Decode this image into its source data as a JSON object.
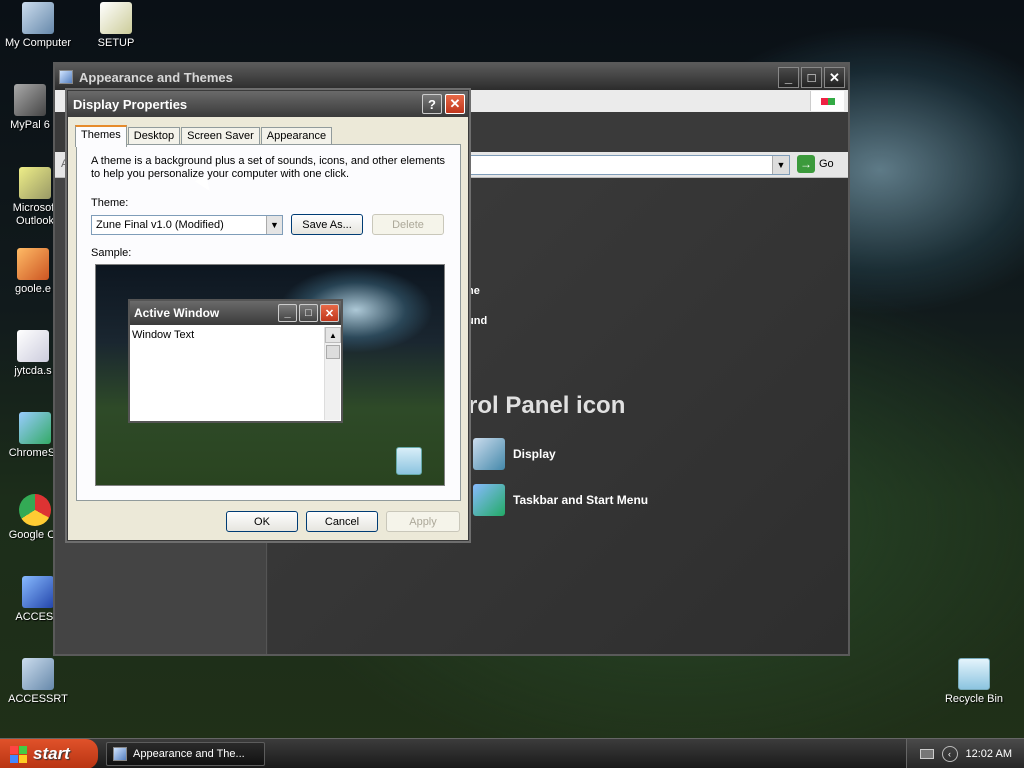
{
  "desktop": {
    "icons": [
      {
        "label": "My Computer",
        "icon": "my-computer-icon"
      },
      {
        "label": "SETUP",
        "icon": "setup-icon"
      },
      {
        "label": "MyPal 6",
        "icon": "mypal-icon"
      },
      {
        "label": "Microsoft Outlook",
        "icon": "outlook-icon"
      },
      {
        "label": "goole.e",
        "icon": "goole-icon"
      },
      {
        "label": "jytcda.s",
        "icon": "jytcda-icon"
      },
      {
        "label": "ChromeSe",
        "icon": "chromese-icon"
      },
      {
        "label": "Google Ch",
        "icon": "google-chrome-icon"
      },
      {
        "label": "ACCESS",
        "icon": "access-icon"
      },
      {
        "label": "ACCESSRT",
        "icon": "accessrt-icon"
      },
      {
        "label": "Recycle Bin",
        "icon": "recycle-bin-icon"
      }
    ]
  },
  "bg_window": {
    "title": "Appearance and Themes",
    "address_label": "A",
    "go_label": "Go",
    "pick_task_items": [
      "ne",
      "und"
    ],
    "cp_heading": "rol Panel icon",
    "cp_links": [
      "Display",
      "Taskbar and Start Menu"
    ]
  },
  "dialog": {
    "title": "Display Properties",
    "help_label": "?",
    "close_label": "✕",
    "tabs": [
      "Themes",
      "Desktop",
      "Screen Saver",
      "Appearance"
    ],
    "active_tab": "Themes",
    "description": "A theme is a background plus a set of sounds, icons, and other elements to help you personalize your computer with one click.",
    "theme_label": "Theme:",
    "theme_value": "Zune Final v1.0 (Modified)",
    "save_as_label": "Save As...",
    "delete_label": "Delete",
    "sample_label": "Sample:",
    "sample_window_title": "Active Window",
    "sample_window_text": "Window Text",
    "ok_label": "OK",
    "cancel_label": "Cancel",
    "apply_label": "Apply"
  },
  "taskbar": {
    "start_label": "start",
    "task_item": "Appearance and The...",
    "clock": "12:02 AM"
  }
}
